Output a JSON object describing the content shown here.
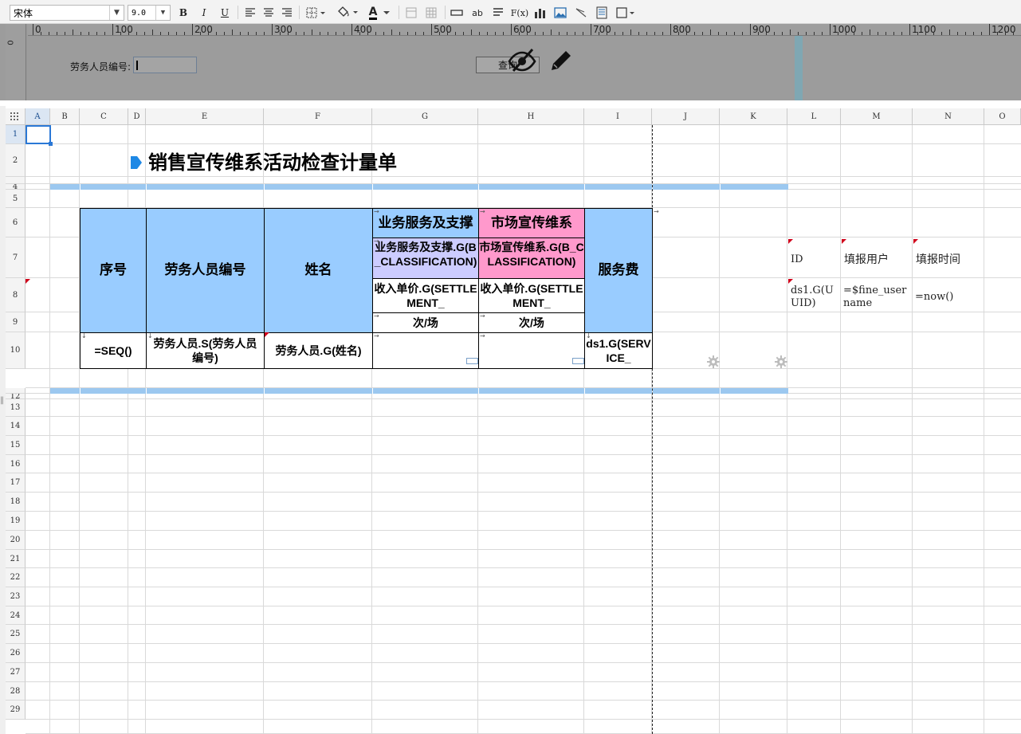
{
  "toolbar": {
    "font_name": "宋体",
    "font_size": "9.0",
    "bold": "B",
    "italic": "I",
    "underline": "U",
    "text_wrap": "ab",
    "formula": "F(x)",
    "font_color_letter": "A"
  },
  "ruler": {
    "zero": "0",
    "labels": [
      "0",
      "100",
      "200",
      "300",
      "400",
      "500",
      "600",
      "700",
      "800",
      "900",
      "1000",
      "1100",
      "1200"
    ]
  },
  "param": {
    "label": "劳务人员编号:",
    "input_value": "",
    "query_button": "查询"
  },
  "columns": [
    "A",
    "B",
    "C",
    "D",
    "E",
    "F",
    "G",
    "H",
    "I",
    "J",
    "K",
    "L",
    "M",
    "N",
    "O"
  ],
  "rows": [
    "1",
    "2",
    "4",
    "5",
    "6",
    "7",
    "8",
    "9",
    "10",
    "12",
    "13",
    "14",
    "15",
    "16",
    "17",
    "18",
    "19",
    "20",
    "21",
    "22",
    "23",
    "24",
    "25",
    "26",
    "27",
    "28",
    "29"
  ],
  "report": {
    "title": "销售宣传维系活动检查计量单",
    "headers": {
      "seq": "序号",
      "staff_no": "劳务人员编号",
      "name": "姓名",
      "business": "业务服务及支撑",
      "market": "市场宣传维系",
      "business_formula": "业务服务及支撑.G(B_CLASSIFICATION)",
      "market_formula": "市场宣传维系.G(B_CLASSIFICATION)",
      "unit_price_g": "收入单价.G(SETTLEMENT_",
      "unit_price_h": "收入单价.G(SETTLEMENT_",
      "unit_g": "次/场",
      "unit_h": "次/场",
      "service_fee": "服务费"
    },
    "data_row": {
      "seq": "=SEQ()",
      "staff_no": "劳务人员.S(劳务人员编号)",
      "name": "劳务人员.G(姓名)",
      "service": "ds1.G(SERVICE_"
    },
    "side": {
      "id_label": "ID",
      "fill_user_label": "填报用户",
      "fill_time_label": "填报时间",
      "id_value": "ds1.G(UUID)",
      "user_value": "=$fine_username",
      "time_value": "=now()"
    }
  },
  "colors": {
    "header_blue": "#99ccff",
    "lavender": "#ccccff",
    "pink": "#ff99cc",
    "band": "#9cc8f0",
    "selection": "#2a78d6",
    "title_marker": "#1e88e5"
  }
}
